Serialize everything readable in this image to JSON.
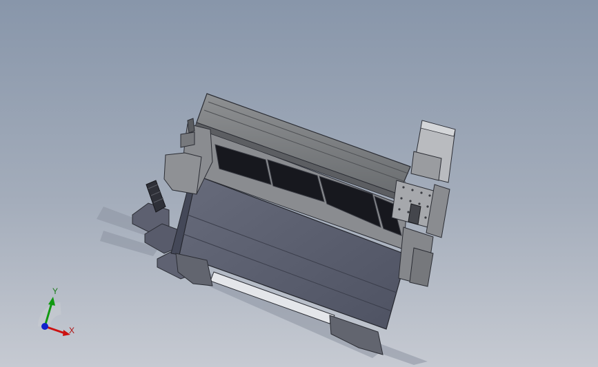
{
  "triad": {
    "x_label": "X",
    "y_label": "Y"
  },
  "colors": {
    "background_top": "#8896aa",
    "background_bottom": "#c6cad2",
    "machine_body": "#5a5e6e",
    "machine_frame": "#7a7d80",
    "table_surface": "#1c1d24",
    "axis_x": "#cc1111",
    "axis_y": "#119911",
    "axis_z": "#1122cc"
  }
}
